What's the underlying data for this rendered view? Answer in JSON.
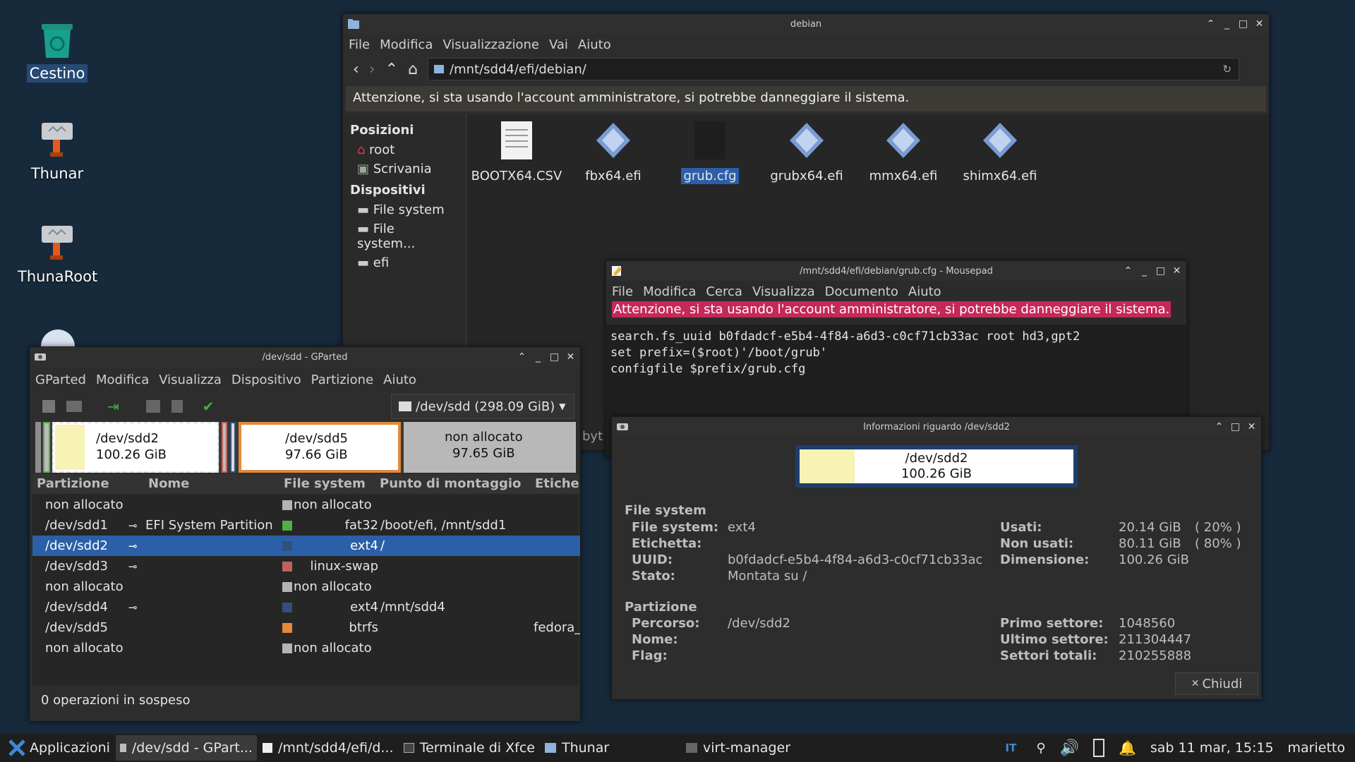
{
  "desktop": {
    "icons": [
      {
        "label": "Cestino"
      },
      {
        "label": "Thunar"
      },
      {
        "label": "ThunaRoot"
      }
    ]
  },
  "thunar": {
    "title": "debian",
    "menu": [
      "File",
      "Modifica",
      "Visualizzazione",
      "Vai",
      "Aiuto"
    ],
    "path": "/mnt/sdd4/efi/debian/",
    "warning": "Attenzione, si sta usando l'account amministratore, si potrebbe danneggiare il sistema.",
    "sidebar": {
      "places_heading": "Posizioni",
      "places": [
        "root",
        "Scrivania"
      ],
      "devices_heading": "Dispositivi",
      "devices": [
        "File system",
        "File system...",
        "efi"
      ]
    },
    "files": [
      {
        "name": "BOOTX64.CSV"
      },
      {
        "name": "fbx64.efi"
      },
      {
        "name": "grub.cfg"
      },
      {
        "name": "grubx64.efi"
      },
      {
        "name": "mmx64.efi"
      },
      {
        "name": "shimx64.efi"
      }
    ]
  },
  "mousepad": {
    "title": "/mnt/sdd4/efi/debian/grub.cfg - Mousepad",
    "menu": [
      "File",
      "Modifica",
      "Cerca",
      "Visualizza",
      "Documento",
      "Aiuto"
    ],
    "warning": "Attenzione, si sta usando l'account amministratore, si potrebbe danneggiare il sistema.",
    "lines": [
      "search.fs_uuid b0fdadcf-e5b4-4f84-a6d3-c0cf71cb33ac root hd3,gpt2",
      "set prefix=($root)'/boot/grub'",
      "configfile $prefix/grub.cfg"
    ],
    "peek": "byt"
  },
  "gparted": {
    "title": "/dev/sdd - GParted",
    "menu": [
      "GParted",
      "Modifica",
      "Visualizza",
      "Dispositivo",
      "Partizione",
      "Aiuto"
    ],
    "device": "/dev/sdd (298.09 GiB)",
    "map": [
      {
        "name": "/dev/sdd2",
        "size": "100.26 GiB"
      },
      {
        "name": "/dev/sdd5",
        "size": "97.66 GiB"
      },
      {
        "name": "non allocato",
        "size": "97.65 GiB"
      }
    ],
    "columns": [
      "Partizione",
      "Nome",
      "File system",
      "Punto di montaggio",
      "Etiche"
    ],
    "rows": [
      {
        "part": "non allocato",
        "name": "",
        "fs": "non allocato",
        "mount": "",
        "label": "",
        "color": "#b4b4b4",
        "key": false
      },
      {
        "part": "/dev/sdd1",
        "name": "EFI System Partition",
        "fs": "fat32",
        "mount": "/boot/efi, /mnt/sdd1",
        "label": "",
        "color": "#4fb043",
        "key": true
      },
      {
        "part": "/dev/sdd2",
        "name": "",
        "fs": "ext4",
        "mount": "/",
        "label": "",
        "color": "#31507b",
        "key": true
      },
      {
        "part": "/dev/sdd3",
        "name": "",
        "fs": "linux-swap",
        "mount": "",
        "label": "",
        "color": "#c2625c",
        "key": true
      },
      {
        "part": "non allocato",
        "name": "",
        "fs": "non allocato",
        "mount": "",
        "label": "",
        "color": "#b4b4b4",
        "key": false
      },
      {
        "part": "/dev/sdd4",
        "name": "",
        "fs": "ext4",
        "mount": "/mnt/sdd4",
        "label": "",
        "color": "#31507b",
        "key": true
      },
      {
        "part": "/dev/sdd5",
        "name": "",
        "fs": "btrfs",
        "mount": "",
        "label": "fedora_",
        "color": "#e2893b",
        "key": false
      },
      {
        "part": "non allocato",
        "name": "",
        "fs": "non allocato",
        "mount": "",
        "label": "",
        "color": "#b4b4b4",
        "key": false
      }
    ],
    "status": "0 operazioni in sospeso"
  },
  "info": {
    "title": "Informazioni riguardo /dev/sdd2",
    "graph": {
      "name": "/dev/sdd2",
      "size": "100.26 GiB",
      "used_fraction": 0.2
    },
    "fs_heading": "File system",
    "fs_labels": [
      "File system:",
      "Etichetta:",
      "UUID:",
      "Stato:"
    ],
    "fs_values": [
      "ext4",
      "",
      "b0fdadcf-e5b4-4f84-a6d3-c0cf71cb33ac",
      "Montata su /"
    ],
    "usage_labels": [
      "Usati:",
      "Non usati:",
      "Dimensione:"
    ],
    "usage_values": [
      "20.14 GiB",
      "80.11 GiB",
      "100.26 GiB"
    ],
    "usage_pct": [
      "( 20% )",
      "( 80% )"
    ],
    "part_heading": "Partizione",
    "part_labels": [
      "Percorso:",
      "Nome:",
      "Flag:"
    ],
    "part_values": [
      "/dev/sdd2",
      "",
      ""
    ],
    "sector_labels": [
      "Primo settore:",
      "Ultimo settore:",
      "Settori totali:"
    ],
    "sector_values": [
      "1048560",
      "211304447",
      "210255888"
    ],
    "close": "Chiudi"
  },
  "taskbar": {
    "apps": "Applicazioni",
    "tasks": [
      "/dev/sdd - GPart...",
      "/mnt/sdd4/efi/d...",
      "Terminale di Xfce",
      "Thunar",
      "virt-manager"
    ],
    "lang": "IT",
    "clock": "sab 11 mar, 15:15",
    "user": "marietto"
  },
  "colors": {
    "selection": "#2b5fa8",
    "warn_red": "#c5285a",
    "sdd2_yellow": "#f6f3b4",
    "sdd5_orange": "#e2893b"
  }
}
